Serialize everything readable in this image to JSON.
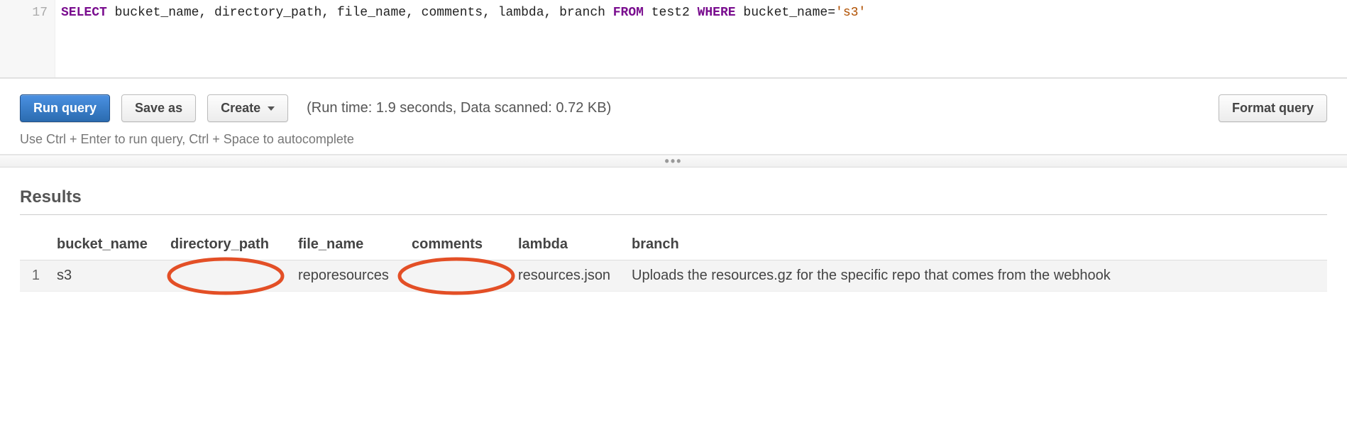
{
  "editor": {
    "line_number": "17",
    "sql_tokens": {
      "select": "SELECT",
      "cols": " bucket_name, directory_path, file_name, comments, lambda, branch ",
      "from": "FROM",
      "table": " test2 ",
      "where": "WHERE",
      "cond_left": " bucket_name",
      "eq": "=",
      "cond_right": "'s3'"
    }
  },
  "toolbar": {
    "run_label": "Run query",
    "save_label": "Save as",
    "create_label": "Create",
    "status_text": "(Run time: 1.9 seconds, Data scanned: 0.72 KB)",
    "format_label": "Format query",
    "hint": "Use Ctrl + Enter to run query, Ctrl + Space to autocomplete"
  },
  "splitter": {
    "dots": "•••"
  },
  "results": {
    "title": "Results",
    "columns": {
      "rownum": "",
      "bucket_name": "bucket_name",
      "directory_path": "directory_path",
      "file_name": "file_name",
      "comments": "comments",
      "lambda": "lambda",
      "branch": "branch"
    },
    "rows": [
      {
        "rownum": "1",
        "bucket_name": "s3",
        "directory_path": "",
        "file_name": "reporesources",
        "comments": "",
        "lambda": "resources.json",
        "branch": "Uploads the resources.gz for the specific repo that comes from the webhook"
      }
    ]
  },
  "annotations": {
    "circle_color": "#e34f26"
  }
}
